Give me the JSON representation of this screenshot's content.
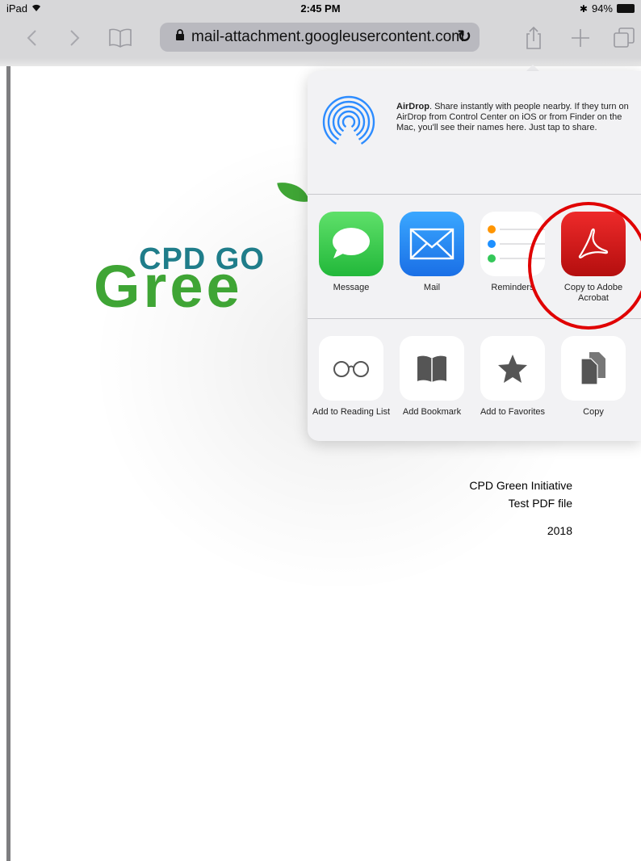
{
  "status_bar": {
    "device": "iPad",
    "time": "2:45 PM",
    "battery": "94%"
  },
  "toolbar": {
    "url": "mail-attachment.googleusercontent.com"
  },
  "document": {
    "logo_top": "CPD GO",
    "logo_bottom": "Gree",
    "line1": "CPD Green Initiative",
    "line2": "Test PDF file",
    "year": "2018"
  },
  "share_sheet": {
    "airdrop_title": "AirDrop",
    "airdrop_desc": ". Share instantly with people nearby. If they turn on AirDrop from Control Center on iOS or from Finder on the Mac, you'll see their names here. Just tap to share.",
    "apps": [
      {
        "label": "Message",
        "icon": "message-icon"
      },
      {
        "label": "Mail",
        "icon": "mail-icon"
      },
      {
        "label": "Reminders",
        "icon": "reminders-icon"
      },
      {
        "label": "Copy to Adobe Acrobat",
        "icon": "adobe-acrobat-icon"
      }
    ],
    "actions": [
      {
        "label": "Add to Reading List",
        "icon": "reading-list-icon"
      },
      {
        "label": "Add Bookmark",
        "icon": "bookmark-icon"
      },
      {
        "label": "Add to Favorites",
        "icon": "favorites-star-icon"
      },
      {
        "label": "Copy",
        "icon": "copy-icon"
      }
    ]
  },
  "colors": {
    "highlight": "#e00000",
    "logo_teal": "#1f7d8a",
    "logo_green": "#3fa535"
  }
}
